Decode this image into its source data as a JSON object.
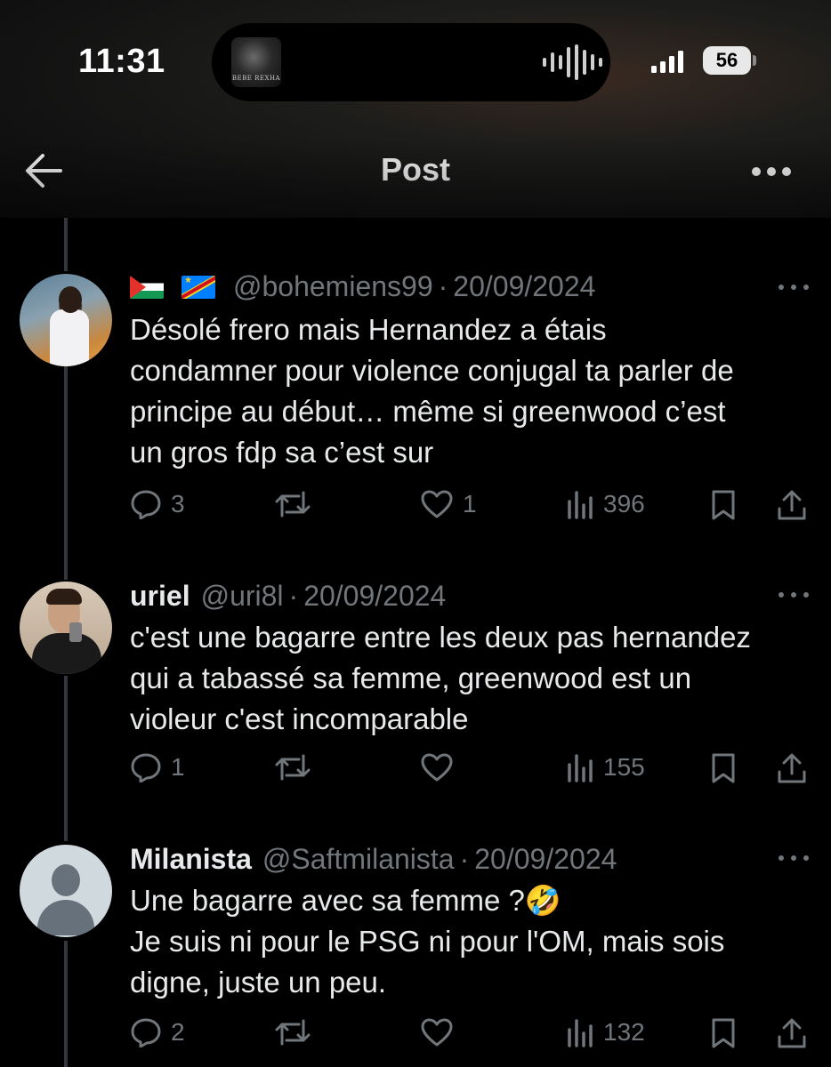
{
  "status_bar": {
    "time": "11:31",
    "now_playing_art_text": "BEBE REXHA",
    "battery": "56"
  },
  "header": {
    "title": "Post",
    "back_icon": "arrow-left-icon",
    "more_icon": "more-horizontal-icon"
  },
  "replies": [
    {
      "flags": [
        "🇵🇸",
        "🇨🇩"
      ],
      "name": "",
      "handle": "@bohemiens99",
      "separator": "·",
      "date": "20/09/2024",
      "text": "Désolé frero mais Hernandez a étais\ncondamner pour violence conjugal ta parler de\nprincipe au début… même si greenwood c’est\nun gros fdp sa c’est sur",
      "replies": "3",
      "reposts": "",
      "likes": "1",
      "views": "396"
    },
    {
      "name": "uriel",
      "handle": "@uri8l",
      "separator": "·",
      "date": "20/09/2024",
      "text": "c'est une bagarre entre les deux pas hernandez\nqui a tabassé sa femme, greenwood est un\nvioleur c'est incomparable",
      "replies": "1",
      "reposts": "",
      "likes": "",
      "views": "155"
    },
    {
      "name": "Milanista",
      "handle": "@Saftmilanista",
      "separator": "·",
      "date": "20/09/2024",
      "text": "Une bagarre avec sa femme ?🤣\nJe suis ni pour le PSG ni pour l'OM, mais sois\ndigne, juste un peu.",
      "replies": "2",
      "reposts": "",
      "likes": "",
      "views": "132"
    }
  ],
  "icons": {
    "reply": "reply-bubble-icon",
    "repost": "repost-icon",
    "like": "heart-icon",
    "views": "views-bar-chart-icon",
    "bookmark": "bookmark-icon",
    "share": "share-icon"
  },
  "colors": {
    "background": "#000000",
    "text": "#e7e9ea",
    "muted": "#71767b",
    "thread_line": "#33363a"
  }
}
